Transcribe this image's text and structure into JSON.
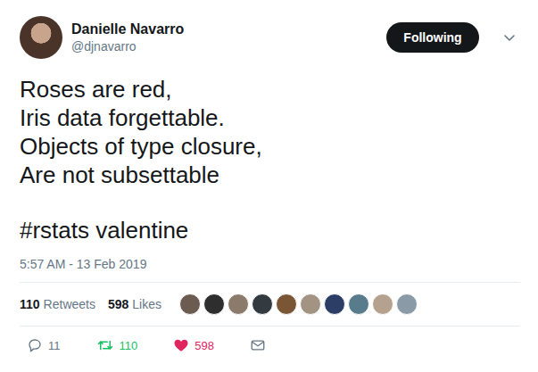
{
  "author": {
    "name": "Danielle Navarro",
    "handle": "@djnavarro"
  },
  "follow_button": {
    "label": "Following"
  },
  "body_lines": [
    "Roses are red,",
    "Iris data forgettable.",
    "Objects of type closure,",
    "Are not subsettable"
  ],
  "hashtag_line": "#rstats valentine",
  "timestamp": "5:57 AM - 13 Feb 2019",
  "stats": [
    {
      "count": "110",
      "label": "Retweets"
    },
    {
      "count": "598",
      "label": "Likes"
    }
  ],
  "likers": [
    {
      "color": "#6b5b50"
    },
    {
      "color": "#2e2e2e"
    },
    {
      "color": "#8c7b6b"
    },
    {
      "color": "#333a40"
    },
    {
      "color": "#7a5636"
    },
    {
      "color": "#a39383"
    },
    {
      "color": "#2c3e66"
    },
    {
      "color": "#587c8c"
    },
    {
      "color": "#b4a28e"
    },
    {
      "color": "#8a9aa6"
    }
  ],
  "actions": [
    {
      "kind": "reply",
      "count": "11",
      "active": false
    },
    {
      "kind": "retweet",
      "count": "110",
      "active": true
    },
    {
      "kind": "like",
      "count": "598",
      "active": true
    },
    {
      "kind": "mail",
      "active": false
    }
  ]
}
